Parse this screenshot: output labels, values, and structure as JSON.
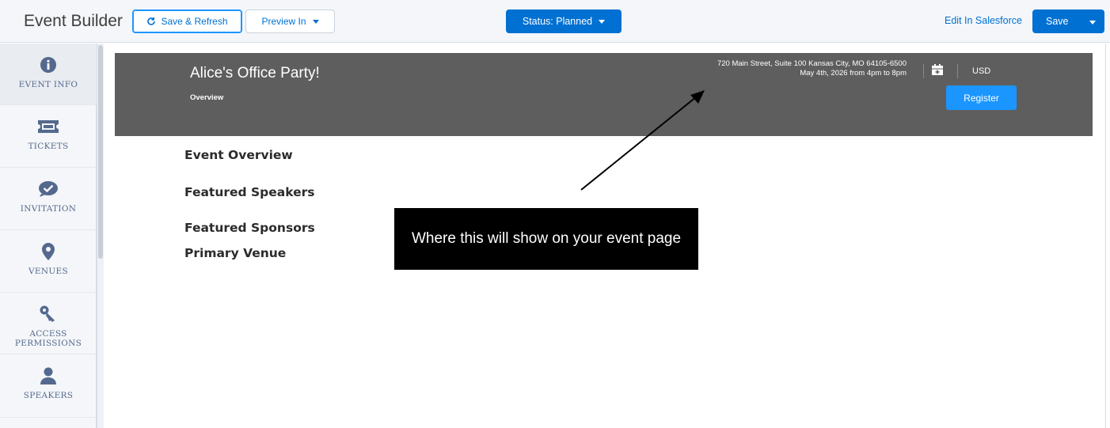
{
  "header": {
    "app_title": "Event Builder",
    "save_refresh_label": "Save & Refresh",
    "preview_label": "Preview In",
    "status_label": "Status: Planned",
    "edit_link_label": "Edit In Salesforce",
    "save_label": "Save"
  },
  "sidebar": {
    "items": [
      {
        "label": "EVENT INFO",
        "icon": "info-icon"
      },
      {
        "label": "TICKETS",
        "icon": "ticket-icon"
      },
      {
        "label": "INVITATION",
        "icon": "check-bubble-icon"
      },
      {
        "label": "VENUES",
        "icon": "map-pin-icon"
      },
      {
        "label": "ACCESS PERMISSIONS",
        "icon": "key-icon"
      },
      {
        "label": "SPEAKERS",
        "icon": "user-icon"
      }
    ]
  },
  "event": {
    "name": "Alice's Office Party!",
    "tab": "Overview",
    "address": "720 Main Street, Suite 100 Kansas City, MO 64105-6500",
    "date_line": "May 4th, 2026 from 4pm to 8pm",
    "currency": "USD",
    "register_label": "Register"
  },
  "sections": [
    "Event Overview",
    "Featured Speakers",
    "Featured Sponsors",
    "Primary Venue"
  ],
  "annotation": {
    "text": "Where this will show on your event page"
  },
  "colors": {
    "brand_blue": "#0070d2",
    "register_blue": "#1b96ff",
    "hero_gray": "#5e5e5e",
    "sidebar_icon": "#54698d"
  }
}
